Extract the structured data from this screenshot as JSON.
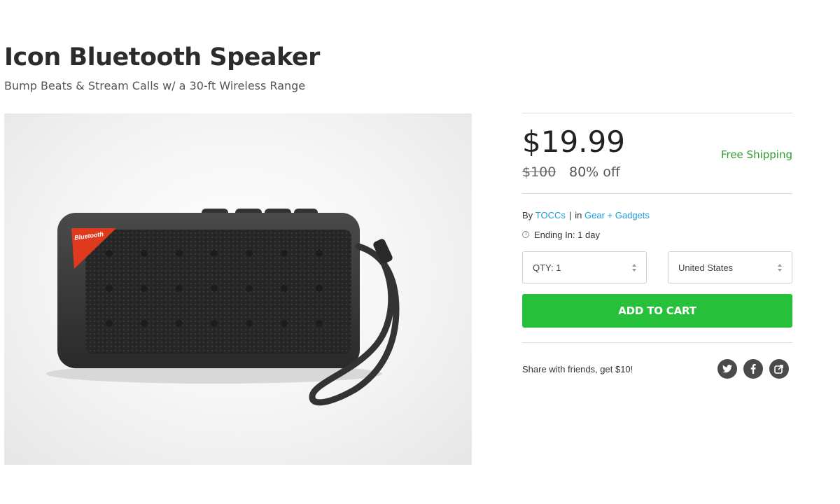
{
  "product": {
    "title": "Icon Bluetooth Speaker",
    "subtitle": "Bump Beats & Stream Calls w/ a 30-ft Wireless Range",
    "image_label": "Bluetooth"
  },
  "pricing": {
    "price": "$19.99",
    "original_price": "$100",
    "discount": "80% off",
    "shipping": "Free Shipping"
  },
  "meta": {
    "by_label": "By",
    "vendor": "TOCCs",
    "separator": "|",
    "in_label": "in",
    "category": "Gear + Gadgets",
    "ending": "Ending In: 1 day"
  },
  "selects": {
    "qty": "QTY: 1",
    "country": "United States"
  },
  "cart": {
    "label": "ADD TO CART"
  },
  "share": {
    "text": "Share with friends, get $10!",
    "icons": [
      "twitter-icon",
      "facebook-icon",
      "share-icon"
    ]
  },
  "colors": {
    "cart_green": "#27c03a",
    "shipping_green": "#2e9b2e",
    "link_blue": "#1e9bd8",
    "speaker_red": "#e03a1e"
  }
}
